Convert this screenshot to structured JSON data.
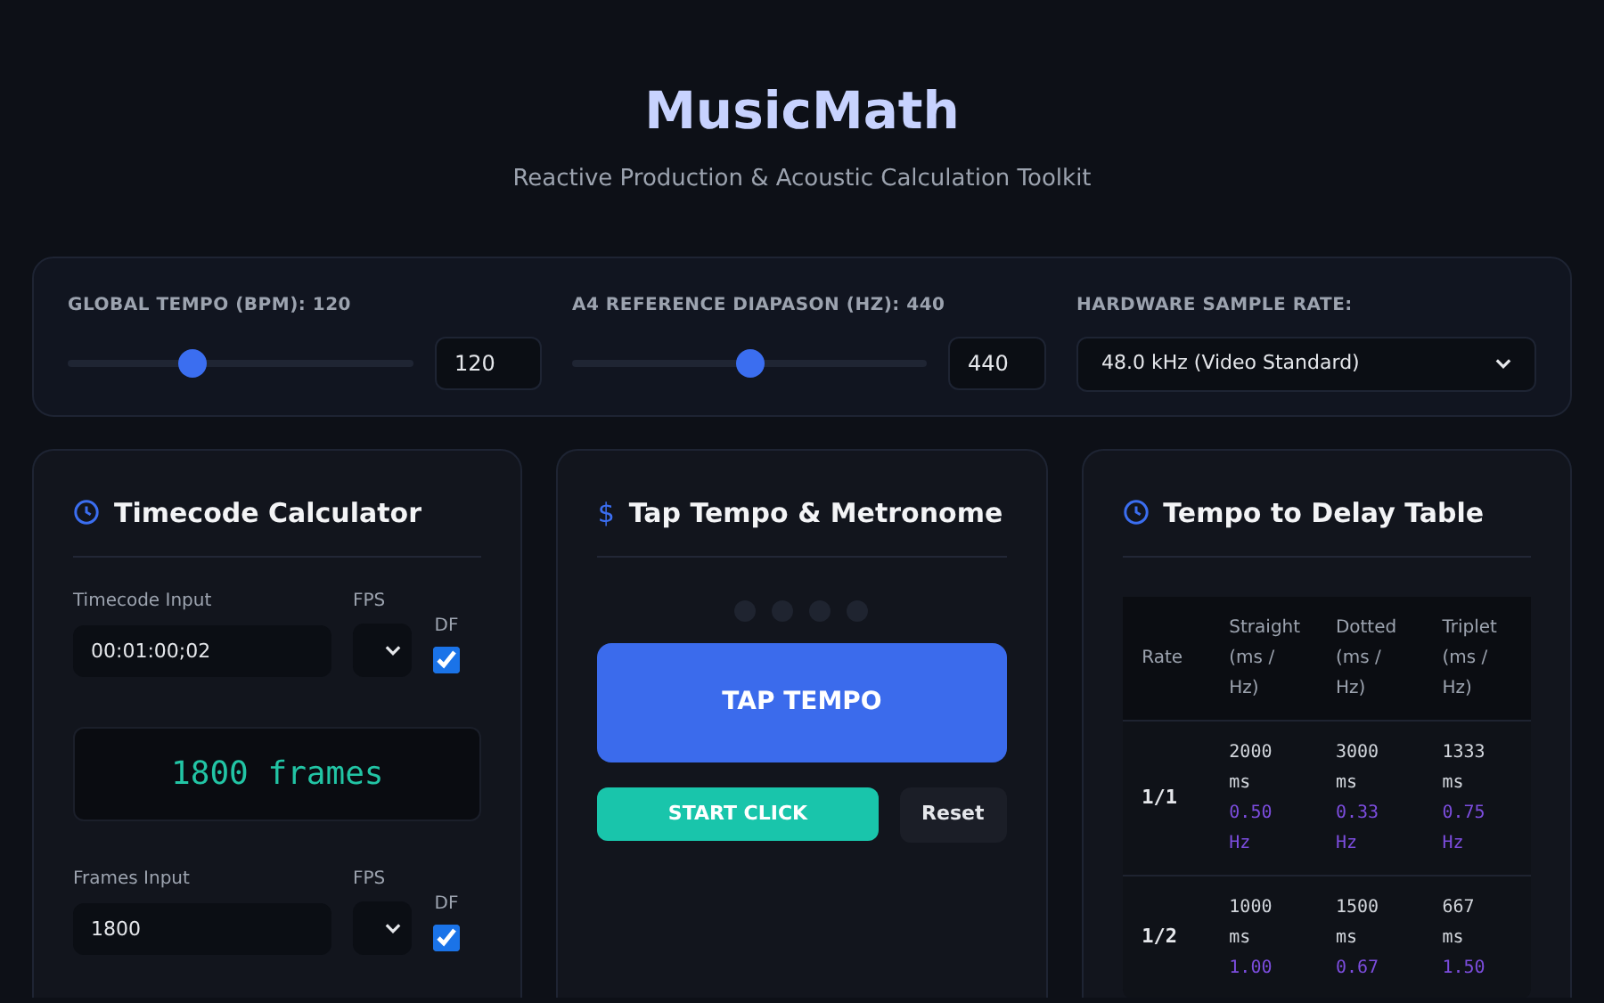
{
  "header": {
    "title": "MusicMath",
    "subtitle": "Reactive Production & Acoustic Calculation Toolkit"
  },
  "globals": {
    "tempo": {
      "label": "GLOBAL TEMPO (BPM): 120",
      "level": 0.36,
      "value": "120"
    },
    "diapason": {
      "label": "A4 REFERENCE DIAPASON (HZ): 440",
      "level": 0.5,
      "value": "440"
    },
    "sample_rate": {
      "label": "HARDWARE SAMPLE RATE:",
      "value": "48.0 kHz (Video Standard)"
    }
  },
  "timecode": {
    "title": "Timecode Calculator",
    "timecode_input": {
      "label": "Timecode Input",
      "value": "00:01:00;02",
      "fps_label": "FPS",
      "df_label": "DF",
      "df_checked": true
    },
    "result": "1800 frames",
    "frames_input": {
      "label": "Frames Input",
      "value": "1800",
      "fps_label": "FPS",
      "df_label": "DF",
      "df_checked": true
    }
  },
  "tap": {
    "title": "Tap Tempo & Metronome",
    "icon": "$",
    "tap_button": "TAP TEMPO",
    "start_button": "START CLICK",
    "reset_button": "Reset"
  },
  "delay": {
    "title": "Tempo to Delay Table",
    "columns": [
      "Rate",
      "Straight (ms / Hz)",
      "Dotted (ms / Hz)",
      "Triplet (ms / Hz)"
    ],
    "rows": [
      {
        "cells": [
          {
            "kind": "rate",
            "text": "1/1"
          },
          {
            "kind": "delay",
            "ms": "2000 ms",
            "hz": "0.50 Hz"
          },
          {
            "kind": "delay",
            "ms": "3000 ms",
            "hz": "0.33 Hz"
          },
          {
            "kind": "delay",
            "ms": "1333 ms",
            "hz": "0.75 Hz"
          }
        ]
      },
      {
        "cells": [
          {
            "kind": "rate",
            "text": "1/2"
          },
          {
            "kind": "delay",
            "ms": "1000 ms",
            "hz": "1.00"
          },
          {
            "kind": "delay",
            "ms": "1500 ms",
            "hz": "0.67"
          },
          {
            "kind": "delay",
            "ms": "667 ms",
            "hz": "1.50"
          }
        ]
      }
    ]
  }
}
